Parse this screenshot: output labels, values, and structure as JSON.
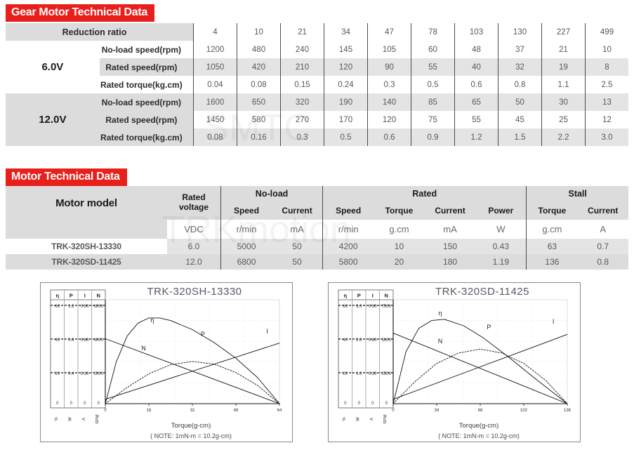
{
  "accent_color": "#e8201c",
  "gear_section": {
    "title": "Gear Motor Technical Data",
    "ratio_label": "Reduction ratio",
    "ratios": [
      "4",
      "10",
      "21",
      "34",
      "47",
      "78",
      "103",
      "130",
      "227",
      "499"
    ],
    "groups": [
      {
        "voltage": "6.0V",
        "rows": [
          {
            "label": "No-load speed(rpm)",
            "values": [
              "1200",
              "480",
              "240",
              "145",
              "105",
              "60",
              "48",
              "37",
              "21",
              "10"
            ]
          },
          {
            "label": "Rated speed(rpm)",
            "values": [
              "1050",
              "420",
              "210",
              "120",
              "90",
              "55",
              "40",
              "32",
              "19",
              "8"
            ]
          },
          {
            "label": "Rated torque(kg.cm)",
            "values": [
              "0.04",
              "0.08",
              "0.15",
              "0.24",
              "0.3",
              "0.5",
              "0.6",
              "0.8",
              "1.1",
              "2.5"
            ]
          }
        ]
      },
      {
        "voltage": "12.0V",
        "rows": [
          {
            "label": "No-load speed(rpm)",
            "values": [
              "1600",
              "650",
              "320",
              "190",
              "140",
              "85",
              "65",
              "50",
              "30",
              "13"
            ]
          },
          {
            "label": "Rated speed(rpm)",
            "values": [
              "1450",
              "580",
              "270",
              "170",
              "120",
              "75",
              "55",
              "45",
              "25",
              "12"
            ]
          },
          {
            "label": "Rated torque(kg.cm)",
            "values": [
              "0.08",
              "0.16",
              "0.3",
              "0.5",
              "0.6",
              "0.9",
              "1.2",
              "1.5",
              "2.2",
              "3.0"
            ]
          }
        ]
      }
    ]
  },
  "motor_section": {
    "title": "Motor Technical Data",
    "model_header": "Motor model",
    "voltage_header_line1": "Rated",
    "voltage_header_line2": "voltage",
    "group_headers": [
      "No-load",
      "Rated",
      "Stall"
    ],
    "sub_headers": [
      "Speed",
      "Current",
      "Speed",
      "Torque",
      "Current",
      "Power",
      "Torque",
      "Current"
    ],
    "units_voltage": "VDC",
    "units": [
      "r/min",
      "mA",
      "r/min",
      "g.cm",
      "mA",
      "W",
      "g.cm",
      "A"
    ],
    "rows": [
      {
        "model": "TRK-320SH-13330",
        "voltage": "6.0",
        "values": [
          "5000",
          "50",
          "4200",
          "10",
          "150",
          "0.43",
          "63",
          "0.7"
        ]
      },
      {
        "model": "TRK-320SD-11425",
        "voltage": "12.0",
        "values": [
          "6800",
          "50",
          "5800",
          "20",
          "180",
          "1.19",
          "136",
          "0.8"
        ]
      }
    ]
  },
  "charts": [
    {
      "title": "TRK-320SH-13330",
      "xlabel": "Torque(g-cm)",
      "note": "( NOTE: 1mN-m = 10.2g-cm)",
      "legend_headers": [
        "η",
        "P",
        "I",
        "N"
      ],
      "axis_units": [
        "%",
        "W",
        "A",
        "RPM"
      ],
      "scale_rows": [
        [
          "60",
          "1.2",
          "0.90",
          "6000"
        ],
        [
          "40",
          "0.8",
          "0.60",
          "4000"
        ],
        [
          "20",
          "0.4",
          "0.30",
          "2000"
        ],
        [
          "0",
          "0",
          "0",
          "0"
        ]
      ],
      "x_ticks": [
        "0",
        "16",
        "32",
        "48",
        "64"
      ],
      "curve_labels": [
        "η",
        "P",
        "I",
        "N"
      ],
      "chart_data": {
        "type": "line",
        "title": "TRK-320SH-13330",
        "xlabel": "Torque(g-cm)",
        "ylabel": "η(%) / P(W) / I(A) / N(RPM)",
        "xlim": [
          0,
          64
        ],
        "x_ticks": [
          0,
          16,
          32,
          48,
          64
        ],
        "grid": true,
        "legend": "inline-curve-labels",
        "series": [
          {
            "name": "η",
            "unit": "%",
            "ylim": [
              0,
              80
            ],
            "y_ticks": [
              0,
              20,
              40,
              60
            ],
            "x": [
              0,
              4,
              8,
              12,
              16,
              20,
              24,
              32,
              40,
              48,
              56,
              64
            ],
            "y": [
              0,
              32,
              52,
              62,
              66,
              66,
              64,
              57,
              47,
              35,
              20,
              0
            ]
          },
          {
            "name": "P",
            "unit": "W",
            "ylim": [
              0,
              1.6
            ],
            "y_ticks": [
              0,
              0.4,
              0.8,
              1.2
            ],
            "x": [
              0,
              8,
              16,
              24,
              32,
              40,
              48,
              56,
              64
            ],
            "y": [
              0,
              0.25,
              0.46,
              0.6,
              0.65,
              0.61,
              0.48,
              0.28,
              0
            ]
          },
          {
            "name": "I",
            "unit": "A",
            "ylim": [
              0,
              1.2
            ],
            "y_ticks": [
              0,
              0.3,
              0.6,
              0.9
            ],
            "x": [
              0,
              64
            ],
            "y": [
              0.05,
              0.7
            ]
          },
          {
            "name": "N",
            "unit": "RPM",
            "ylim": [
              0,
              8000
            ],
            "y_ticks": [
              0,
              2000,
              4000,
              6000
            ],
            "x": [
              0,
              64
            ],
            "y": [
              5000,
              0
            ]
          }
        ]
      }
    },
    {
      "title": "TRK-320SD-11425",
      "xlabel": "Torque(g-cm)",
      "note": "( NOTE: 1mN-m = 10.2g-cm)",
      "legend_headers": [
        "η",
        "P",
        "I",
        "N"
      ],
      "axis_units": [
        "%",
        "W",
        "A",
        "RPM"
      ],
      "scale_rows": [
        [
          "60",
          "3.0",
          "0.90",
          "7500"
        ],
        [
          "40",
          "2.0",
          "0.60",
          "5000"
        ],
        [
          "20",
          "1.0",
          "0.30",
          "2500"
        ],
        [
          "0",
          "0",
          "0",
          "0"
        ]
      ],
      "x_ticks": [
        "0",
        "34",
        "68",
        "102",
        "136"
      ],
      "curve_labels": [
        "η",
        "P",
        "I",
        "N"
      ],
      "chart_data": {
        "type": "line",
        "title": "TRK-320SD-11425",
        "xlabel": "Torque(g-cm)",
        "ylabel": "η(%) / P(W) / I(A) / N(RPM)",
        "xlim": [
          0,
          136
        ],
        "x_ticks": [
          0,
          34,
          68,
          102,
          136
        ],
        "grid": true,
        "legend": "inline-curve-labels",
        "series": [
          {
            "name": "η",
            "unit": "%",
            "ylim": [
              0,
              80
            ],
            "y_ticks": [
              0,
              20,
              40,
              60
            ],
            "x": [
              0,
              10,
              20,
              30,
              40,
              55,
              70,
              90,
              110,
              136
            ],
            "y": [
              0,
              40,
              58,
              64,
              65,
              60,
              51,
              36,
              20,
              0
            ]
          },
          {
            "name": "P",
            "unit": "W",
            "ylim": [
              0,
              4.0
            ],
            "y_ticks": [
              0,
              1.0,
              2.0,
              3.0
            ],
            "x": [
              0,
              17,
              34,
              51,
              68,
              85,
              102,
              119,
              136
            ],
            "y": [
              0,
              0.85,
              1.55,
              1.95,
              2.1,
              1.95,
              1.55,
              0.9,
              0
            ]
          },
          {
            "name": "I",
            "unit": "A",
            "ylim": [
              0,
              1.2
            ],
            "y_ticks": [
              0,
              0.3,
              0.6,
              0.9
            ],
            "x": [
              0,
              136
            ],
            "y": [
              0.05,
              0.8
            ]
          },
          {
            "name": "N",
            "unit": "RPM",
            "ylim": [
              0,
              10000
            ],
            "y_ticks": [
              0,
              2500,
              5000,
              7500
            ],
            "x": [
              0,
              136
            ],
            "y": [
              6800,
              0
            ]
          }
        ]
      }
    }
  ]
}
